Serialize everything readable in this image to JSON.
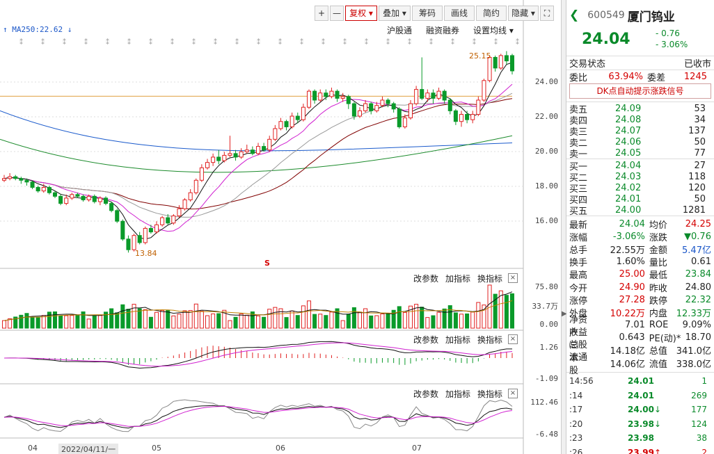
{
  "toolbar": {
    "plus": "+",
    "minus": "—",
    "fuquan": "复权",
    "diejia": "叠加",
    "chouma": "筹码",
    "huaxian": "画线",
    "jianyue": "简约",
    "yincang": "隐藏",
    "fullscreen": "⛶"
  },
  "ma_label": "MA250:22.62",
  "links": {
    "hgt": "沪股通",
    "rzrq": "融资融券",
    "ma_setting": "设置均线"
  },
  "sub_tools": {
    "param": "改参数",
    "add": "加指标",
    "swap": "换指标",
    "close": "×"
  },
  "annotations": {
    "high": "25.15",
    "low": "13.84",
    "s_mark": "S"
  },
  "y_main": [
    "24.00",
    "22.00",
    "20.00",
    "18.00",
    "16.00"
  ],
  "y_vol": [
    "75.80",
    "33.7万",
    "0.00"
  ],
  "y_macd": [
    "1.26",
    "-1.09"
  ],
  "y_kdj": [
    "112.46",
    "-6.48"
  ],
  "x_labels": [
    "04",
    "2022/04/11/一",
    "05",
    "06",
    "07"
  ],
  "chart_data": {
    "type": "candlestick",
    "ylim": [
      13.5,
      25.6
    ],
    "ma250_value": 22.62,
    "candles": [
      [
        17.9,
        18.0,
        18.2,
        17.8
      ],
      [
        18.0,
        18.1,
        18.3,
        17.9
      ],
      [
        18.1,
        18.0,
        18.2,
        17.9
      ],
      [
        18.0,
        17.9,
        18.1,
        17.7
      ],
      [
        17.9,
        17.8,
        18.0,
        17.6
      ],
      [
        17.8,
        17.5,
        17.9,
        17.4
      ],
      [
        17.5,
        17.3,
        17.6,
        17.2
      ],
      [
        17.3,
        17.5,
        17.7,
        17.2
      ],
      [
        17.5,
        17.2,
        17.6,
        17.1
      ],
      [
        17.2,
        17.0,
        17.3,
        16.9
      ],
      [
        17.0,
        16.6,
        17.1,
        16.5
      ],
      [
        16.6,
        16.9,
        17.1,
        16.5
      ],
      [
        16.9,
        17.1,
        17.2,
        16.8
      ],
      [
        17.1,
        17.0,
        17.2,
        16.9
      ],
      [
        17.0,
        16.8,
        17.1,
        16.7
      ],
      [
        16.8,
        17.0,
        17.1,
        16.7
      ],
      [
        17.0,
        16.7,
        17.1,
        16.6
      ],
      [
        16.7,
        16.9,
        17.0,
        16.5
      ],
      [
        16.9,
        16.6,
        17.0,
        16.5
      ],
      [
        16.6,
        16.2,
        16.7,
        16.1
      ],
      [
        16.2,
        15.6,
        16.3,
        15.5
      ],
      [
        15.6,
        14.6,
        15.7,
        14.5
      ],
      [
        14.6,
        14.0,
        14.8,
        13.84
      ],
      [
        14.0,
        14.8,
        14.9,
        13.9
      ],
      [
        14.8,
        14.4,
        15.0,
        14.3
      ],
      [
        14.4,
        15.2,
        15.3,
        14.3
      ],
      [
        15.2,
        15.0,
        15.4,
        14.9
      ],
      [
        15.0,
        15.4,
        15.6,
        14.9
      ],
      [
        15.4,
        15.8,
        15.9,
        15.3
      ],
      [
        15.8,
        15.5,
        16.0,
        15.4
      ],
      [
        15.5,
        15.9,
        16.0,
        15.4
      ],
      [
        15.9,
        16.3,
        16.5,
        15.8
      ],
      [
        16.3,
        16.8,
        16.9,
        16.2
      ],
      [
        16.8,
        17.2,
        17.4,
        16.7
      ],
      [
        17.2,
        17.9,
        18.0,
        17.1
      ],
      [
        17.9,
        18.6,
        18.8,
        17.8
      ],
      [
        18.6,
        18.9,
        19.1,
        18.5
      ],
      [
        18.9,
        19.2,
        19.4,
        18.7
      ],
      [
        19.2,
        19.0,
        19.6,
        18.8
      ],
      [
        19.0,
        19.3,
        19.5,
        18.9
      ],
      [
        19.3,
        19.4,
        20.4,
        19.2
      ],
      [
        19.4,
        19.2,
        19.6,
        19.0
      ],
      [
        19.2,
        19.5,
        19.7,
        19.1
      ],
      [
        19.5,
        19.6,
        19.9,
        19.4
      ],
      [
        19.6,
        19.4,
        19.8,
        19.3
      ],
      [
        19.4,
        19.8,
        20.0,
        19.3
      ],
      [
        19.8,
        19.6,
        20.0,
        19.5
      ],
      [
        19.6,
        20.2,
        20.4,
        19.5
      ],
      [
        20.2,
        20.8,
        21.0,
        20.1
      ],
      [
        20.8,
        21.2,
        21.4,
        20.7
      ],
      [
        21.2,
        20.9,
        21.3,
        20.7
      ],
      [
        20.9,
        21.5,
        21.7,
        20.8
      ],
      [
        21.5,
        21.3,
        21.7,
        21.1
      ],
      [
        21.3,
        22.0,
        22.2,
        21.2
      ],
      [
        22.0,
        22.9,
        23.0,
        21.9
      ],
      [
        22.9,
        22.4,
        23.0,
        22.2
      ],
      [
        22.4,
        22.8,
        23.0,
        22.3
      ],
      [
        22.8,
        22.6,
        23.0,
        22.4
      ],
      [
        22.6,
        22.9,
        23.1,
        22.5
      ],
      [
        22.9,
        22.5,
        23.0,
        22.3
      ],
      [
        22.5,
        22.6,
        22.8,
        22.3
      ],
      [
        22.6,
        22.2,
        22.7,
        21.9
      ],
      [
        22.2,
        21.5,
        22.3,
        21.3
      ],
      [
        21.5,
        21.8,
        22.0,
        21.4
      ],
      [
        21.8,
        22.2,
        22.4,
        21.7
      ],
      [
        22.2,
        21.8,
        22.3,
        21.6
      ],
      [
        21.8,
        22.1,
        22.3,
        21.7
      ],
      [
        22.1,
        22.4,
        22.6,
        22.0
      ],
      [
        22.4,
        22.2,
        22.5,
        22.0
      ],
      [
        22.2,
        21.9,
        22.3,
        21.7
      ],
      [
        21.9,
        20.9,
        22.0,
        20.8
      ],
      [
        20.9,
        21.4,
        21.6,
        20.8
      ],
      [
        21.4,
        22.2,
        22.4,
        21.3
      ],
      [
        22.2,
        23.0,
        23.2,
        22.1
      ],
      [
        23.0,
        22.5,
        24.8,
        22.4
      ],
      [
        22.5,
        22.8,
        23.0,
        22.3
      ],
      [
        22.8,
        22.5,
        23.0,
        22.2
      ],
      [
        22.5,
        22.9,
        23.1,
        22.4
      ],
      [
        22.9,
        22.4,
        23.0,
        22.2
      ],
      [
        22.4,
        21.8,
        22.5,
        21.6
      ],
      [
        21.8,
        21.2,
        21.9,
        21.0
      ],
      [
        21.2,
        21.6,
        21.8,
        20.9
      ],
      [
        21.6,
        21.3,
        21.8,
        21.1
      ],
      [
        21.3,
        21.6,
        21.8,
        21.1
      ],
      [
        21.6,
        22.4,
        22.6,
        21.5
      ],
      [
        22.4,
        23.5,
        23.6,
        22.3
      ],
      [
        23.5,
        24.8,
        24.9,
        23.4
      ],
      [
        24.8,
        24.2,
        24.9,
        24.0
      ],
      [
        24.2,
        24.9,
        25.0,
        24.1
      ],
      [
        24.9,
        24.6,
        25.15,
        24.4
      ],
      [
        24.9,
        24.04,
        25.0,
        23.84
      ]
    ]
  }
}
